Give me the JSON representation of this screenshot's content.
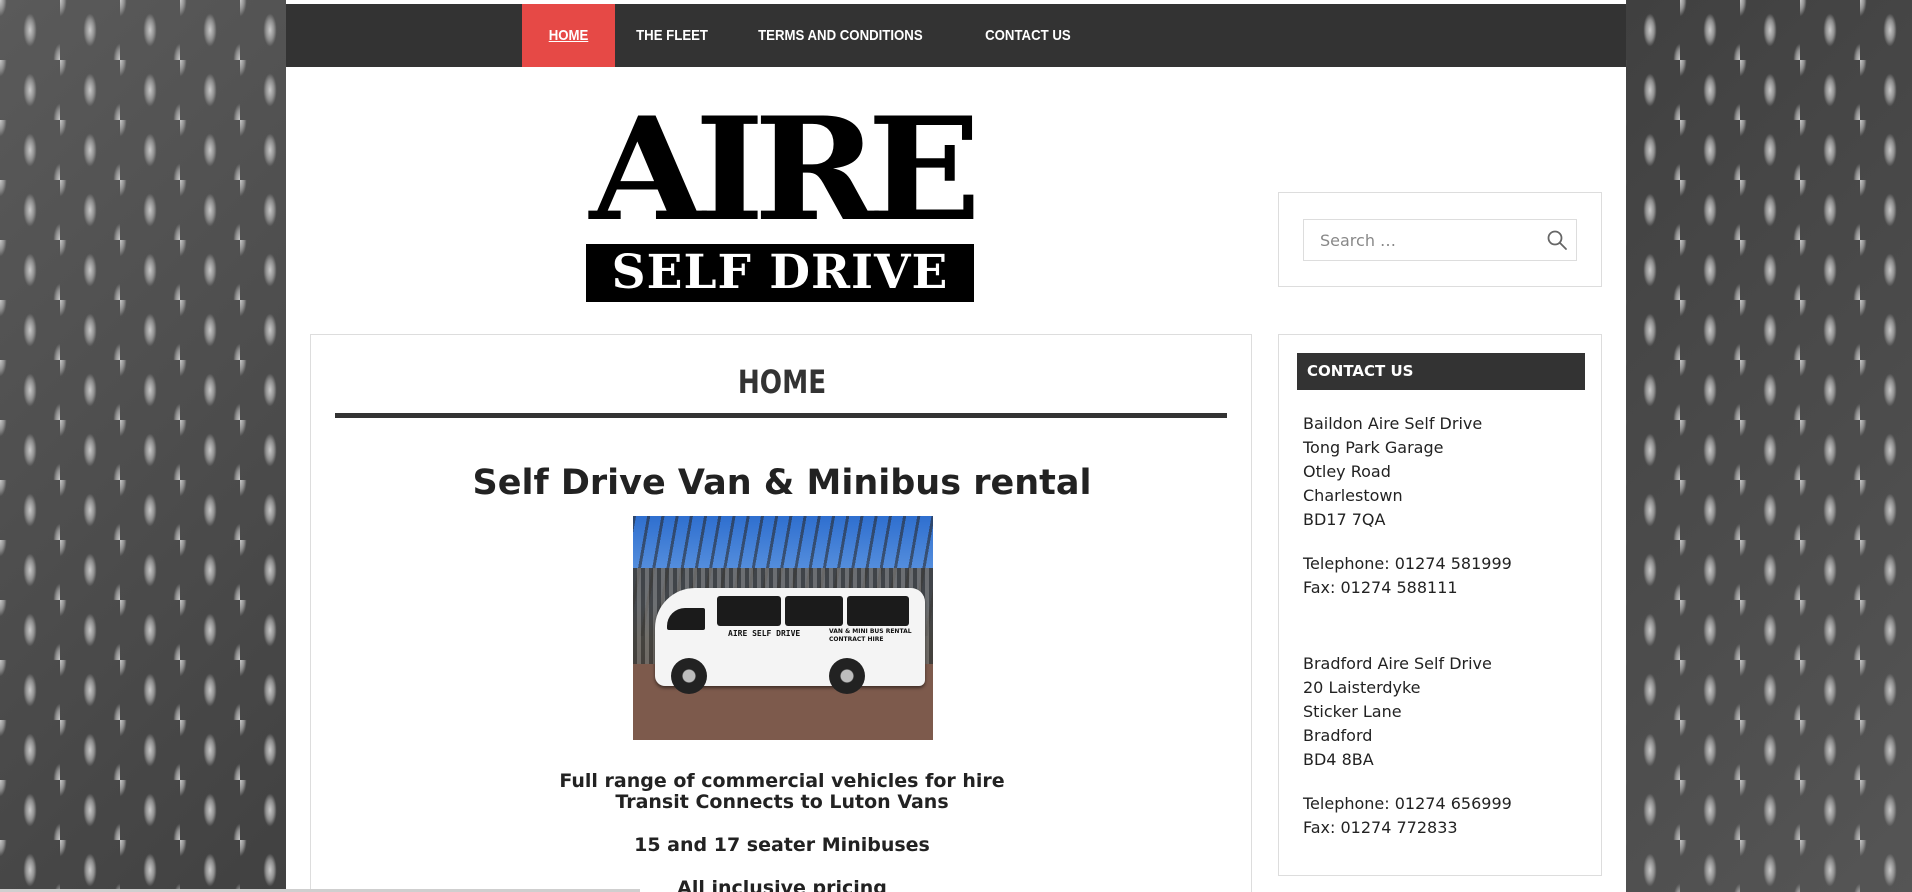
{
  "nav": {
    "items": [
      {
        "label": "HOME",
        "active": true
      },
      {
        "label": "THE FLEET",
        "active": false
      },
      {
        "label": "TERMS AND CONDITIONS",
        "active": false
      },
      {
        "label": "CONTACT US",
        "active": false
      }
    ]
  },
  "logo": {
    "line1": "AIRE",
    "line2": "SELF DRIVE"
  },
  "search": {
    "placeholder": "Search …",
    "icon": "search-icon"
  },
  "main": {
    "title": "HOME",
    "headline": "Self Drive Van & Minibus rental",
    "photo_decal": "AIRE SELF DRIVE",
    "photo_decal_side_1": "VAN & MINI BUS RENTAL",
    "photo_decal_side_2": "CONTRACT HIRE",
    "lines": [
      "Full range of commercial vehicles for hire",
      "Transit Connects to Luton Vans",
      "15 and 17 seater Minibuses",
      "All inclusive pricing"
    ]
  },
  "contact": {
    "title": "CONTACT US",
    "baildon": {
      "address": [
        "Baildon Aire Self Drive",
        "Tong Park Garage",
        "Otley Road",
        "Charlestown",
        "BD17 7QA"
      ],
      "phone": "Telephone: 01274 581999",
      "fax": "Fax: 01274 588111"
    },
    "bradford": {
      "address": [
        "Bradford Aire Self Drive",
        "20 Laisterdyke",
        "Sticker Lane",
        "Bradford",
        "BD4 8BA"
      ],
      "phone": "Telephone: 01274 656999",
      "fax": "Fax: 01274 772833"
    }
  },
  "colors": {
    "nav_bg": "#333333",
    "nav_active": "#e64946",
    "widget_title_bg": "#333333"
  }
}
